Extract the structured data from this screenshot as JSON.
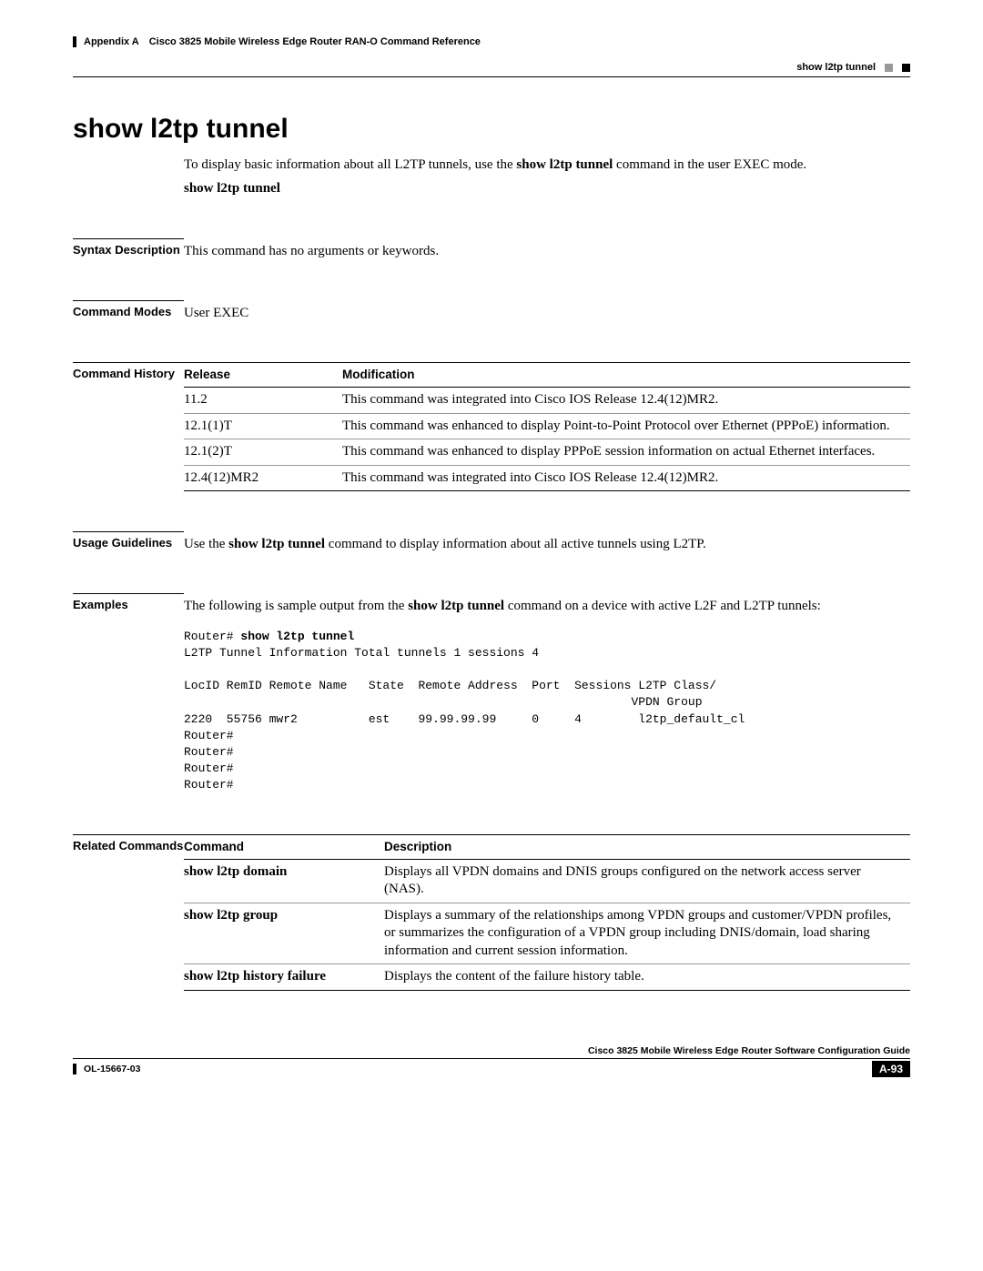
{
  "header": {
    "left": "Appendix A Cisco 3825 Mobile Wireless Edge Router RAN-O Command Reference",
    "right": "show l2tp tunnel"
  },
  "title": "show l2tp tunnel",
  "intro": {
    "pre": "To display basic information about all L2TP tunnels, use the ",
    "cmd": "show l2tp tunnel",
    "post": " command in the user EXEC mode."
  },
  "cmd_line": "show l2tp tunnel",
  "syntax": {
    "label": "Syntax Description",
    "text": "This command has no arguments or keywords."
  },
  "modes": {
    "label": "Command Modes",
    "text": "User EXEC"
  },
  "history": {
    "label": "Command History",
    "headers": {
      "release": "Release",
      "modification": "Modification"
    },
    "rows": [
      {
        "release": "11.2",
        "modification": "This command was integrated into Cisco IOS Release 12.4(12)MR2."
      },
      {
        "release": "12.1(1)T",
        "modification": "This command was enhanced to display Point-to-Point Protocol over Ethernet (PPPoE) information."
      },
      {
        "release": "12.1(2)T",
        "modification": "This command was enhanced to display PPPoE session information on actual Ethernet interfaces."
      },
      {
        "release": "12.4(12)MR2",
        "modification": "This command was integrated into Cisco IOS Release 12.4(12)MR2."
      }
    ]
  },
  "usage": {
    "label": "Usage Guidelines",
    "pre": "Use the ",
    "cmd": "show l2tp tunnel",
    "post": " command to display information about all active tunnels using L2TP."
  },
  "examples": {
    "label": "Examples",
    "pre": "The following is sample output from the ",
    "cmd": "show l2tp tunnel",
    "post": " command on a device with active L2F and L2TP tunnels:",
    "cli_prompt": "Router# ",
    "cli_cmd": "show l2tp tunnel",
    "cli_output": "\nL2TP Tunnel Information Total tunnels 1 sessions 4\n\nLocID RemID Remote Name   State  Remote Address  Port  Sessions L2TP Class/\n                                                               VPDN Group\n2220  55756 mwr2          est    99.99.99.99     0     4        l2tp_default_cl\nRouter#\nRouter#\nRouter#\nRouter#"
  },
  "related": {
    "label": "Related Commands",
    "headers": {
      "command": "Command",
      "description": "Description"
    },
    "rows": [
      {
        "command": "show l2tp domain",
        "description": "Displays all VPDN domains and DNIS groups configured on the network access server (NAS)."
      },
      {
        "command": "show l2tp group",
        "description": "Displays a summary of the relationships among VPDN groups and customer/VPDN profiles, or summarizes the configuration of a VPDN group including DNIS/domain, load sharing information and current session information."
      },
      {
        "command": "show l2tp history failure",
        "description": "Displays the content of the failure history table."
      }
    ]
  },
  "footer": {
    "guide": "Cisco 3825 Mobile Wireless Edge Router Software Configuration Guide",
    "doc": "OL-15667-03",
    "page": "A-93"
  }
}
